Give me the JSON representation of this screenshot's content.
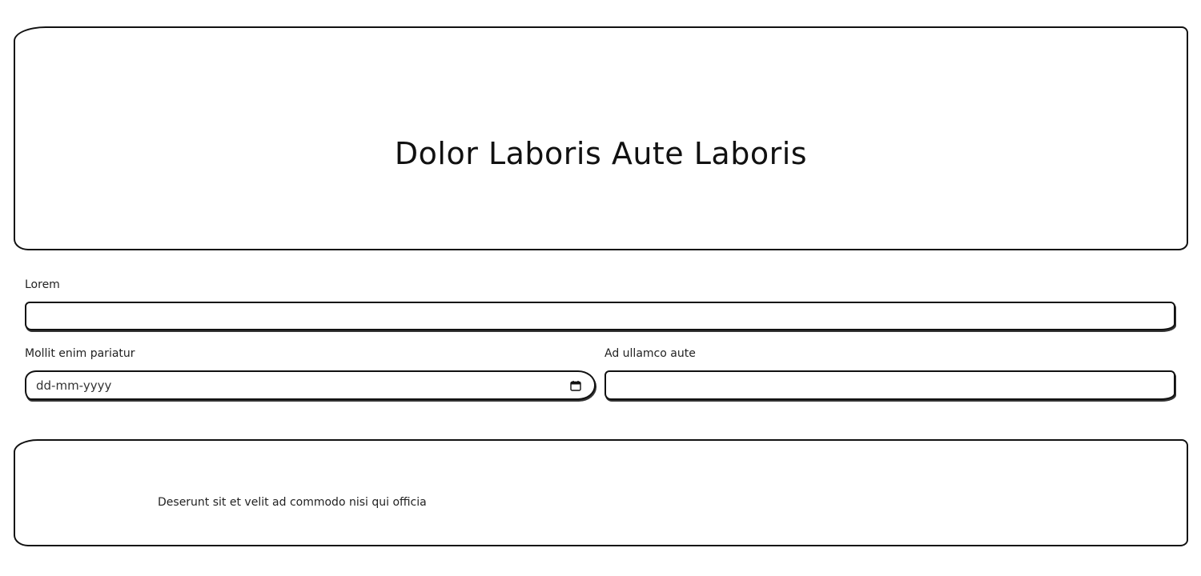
{
  "header": {
    "title": "Dolor Laboris Aute Laboris"
  },
  "form": {
    "field1": {
      "label": "Lorem",
      "value": "",
      "placeholder": ""
    },
    "field2": {
      "label": "Mollit enim pariatur",
      "placeholder": "dd-mm-yyyy",
      "icon": "calendar-icon"
    },
    "field3": {
      "label": "Ad ullamco aute",
      "value": "",
      "placeholder": ""
    }
  },
  "footer": {
    "text": "Deserunt sit et velit ad commodo nisi qui officia"
  },
  "colors": {
    "border": "#111111",
    "background": "#ffffff",
    "text": "#111111"
  }
}
